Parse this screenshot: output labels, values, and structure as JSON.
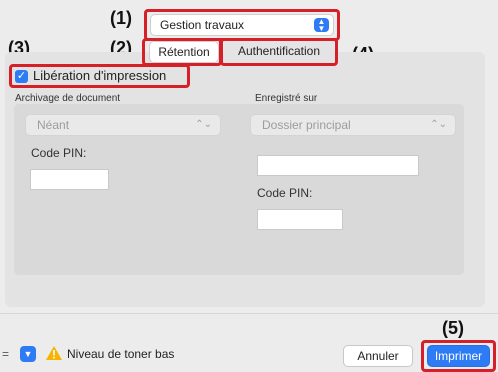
{
  "job_menu": {
    "selected": "Gestion travaux"
  },
  "tabs": [
    {
      "label": "Rétention"
    },
    {
      "label": "Authentification"
    }
  ],
  "callouts": [
    "(1)",
    "(2)",
    "(3)",
    "(4)",
    "(5)"
  ],
  "release": {
    "label": "Libération d'impression",
    "checked": true
  },
  "archive": {
    "label": "Archivage de document",
    "select_value": "Néant",
    "pin_label": "Code PIN:",
    "pin_value": ""
  },
  "stored": {
    "label": "Enregistré sur",
    "select_value": "Dossier principal",
    "name_value": "",
    "pin_label": "Code PIN:",
    "pin_value": ""
  },
  "status": {
    "text": "Niveau de toner bas"
  },
  "buttons": {
    "cancel": "Annuler",
    "print": "Imprimer"
  },
  "colors": {
    "accent": "#2d7cf6",
    "callout_border": "#d5202a",
    "warning": "#f5b400"
  }
}
